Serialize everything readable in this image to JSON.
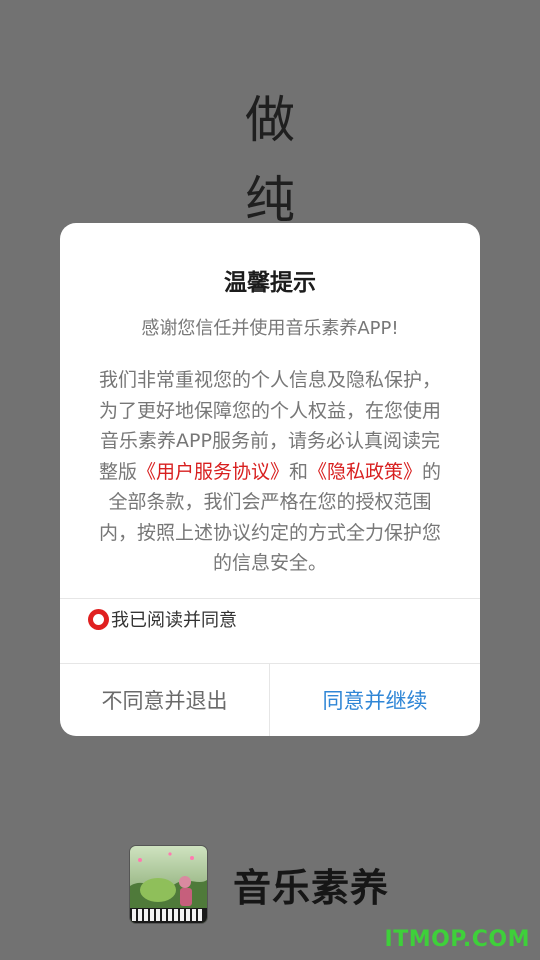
{
  "splash": {
    "slogan_line1": "做",
    "slogan_line2": "纯",
    "brand_name": "音乐素养",
    "logo_icon": "app-logo-icon",
    "watermark": "ITMOP.COM"
  },
  "dialog": {
    "title": "温馨提示",
    "thanks": "感谢您信任并使用音乐素养APP!",
    "body_part1": "我们非常重视您的个人信息及隐私保护，为了更好地保障您的个人权益，在您使用音乐素养APP服务前，请务必认真阅读完整版",
    "link_user_agreement": "《用户服务协议》",
    "body_and": "和",
    "link_privacy_policy": "《隐私政策》",
    "body_part2": "的全部条款，我们会严格在您的授权范围内，按照上述协议约定的方式全力保护您的信息安全。",
    "agree_label": "我已阅读并同意",
    "decline_button": "不同意并退出",
    "accept_button": "同意并继续"
  },
  "colors": {
    "overlay": "#727272",
    "link": "#d81f1f",
    "accept": "#2f86d6",
    "radio": "#e02020",
    "watermark": "#3ed03a"
  }
}
